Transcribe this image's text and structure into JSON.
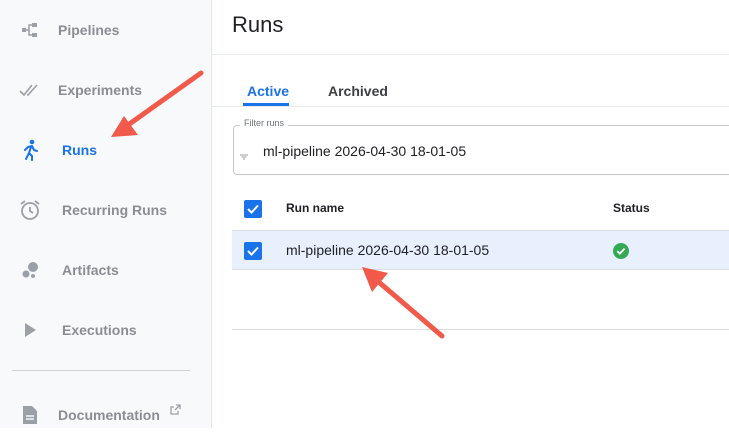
{
  "sidebar": {
    "items": [
      {
        "label": "Pipelines",
        "icon": "pipelines-icon",
        "active": false
      },
      {
        "label": "Experiments",
        "icon": "experiments-icon",
        "active": false
      },
      {
        "label": "Runs",
        "icon": "runs-icon",
        "active": true
      },
      {
        "label": "Recurring Runs",
        "icon": "alarm-clock-icon",
        "active": false
      },
      {
        "label": "Artifacts",
        "icon": "artifacts-icon",
        "active": false
      },
      {
        "label": "Executions",
        "icon": "play-icon",
        "active": false
      }
    ],
    "documentation": {
      "label": "Documentation",
      "icon": "document-icon",
      "external_icon": "external-link-icon"
    }
  },
  "page": {
    "title": "Runs"
  },
  "tabs": [
    {
      "label": "Active",
      "active": true
    },
    {
      "label": "Archived",
      "active": false
    }
  ],
  "filter": {
    "label": "Filter runs",
    "value": "ml-pipeline 2026-04-30 18-01-05"
  },
  "table": {
    "columns": [
      "Run name",
      "Status"
    ],
    "rows": [
      {
        "name": "ml-pipeline 2026-04-30 18-01-05",
        "status_icon": "success-check-icon",
        "selected": true
      }
    ]
  },
  "colors": {
    "accent": "#1a73e8",
    "annotation_arrow": "#f15a4a",
    "success": "#34a853",
    "selected_row": "#e8f0fe"
  }
}
